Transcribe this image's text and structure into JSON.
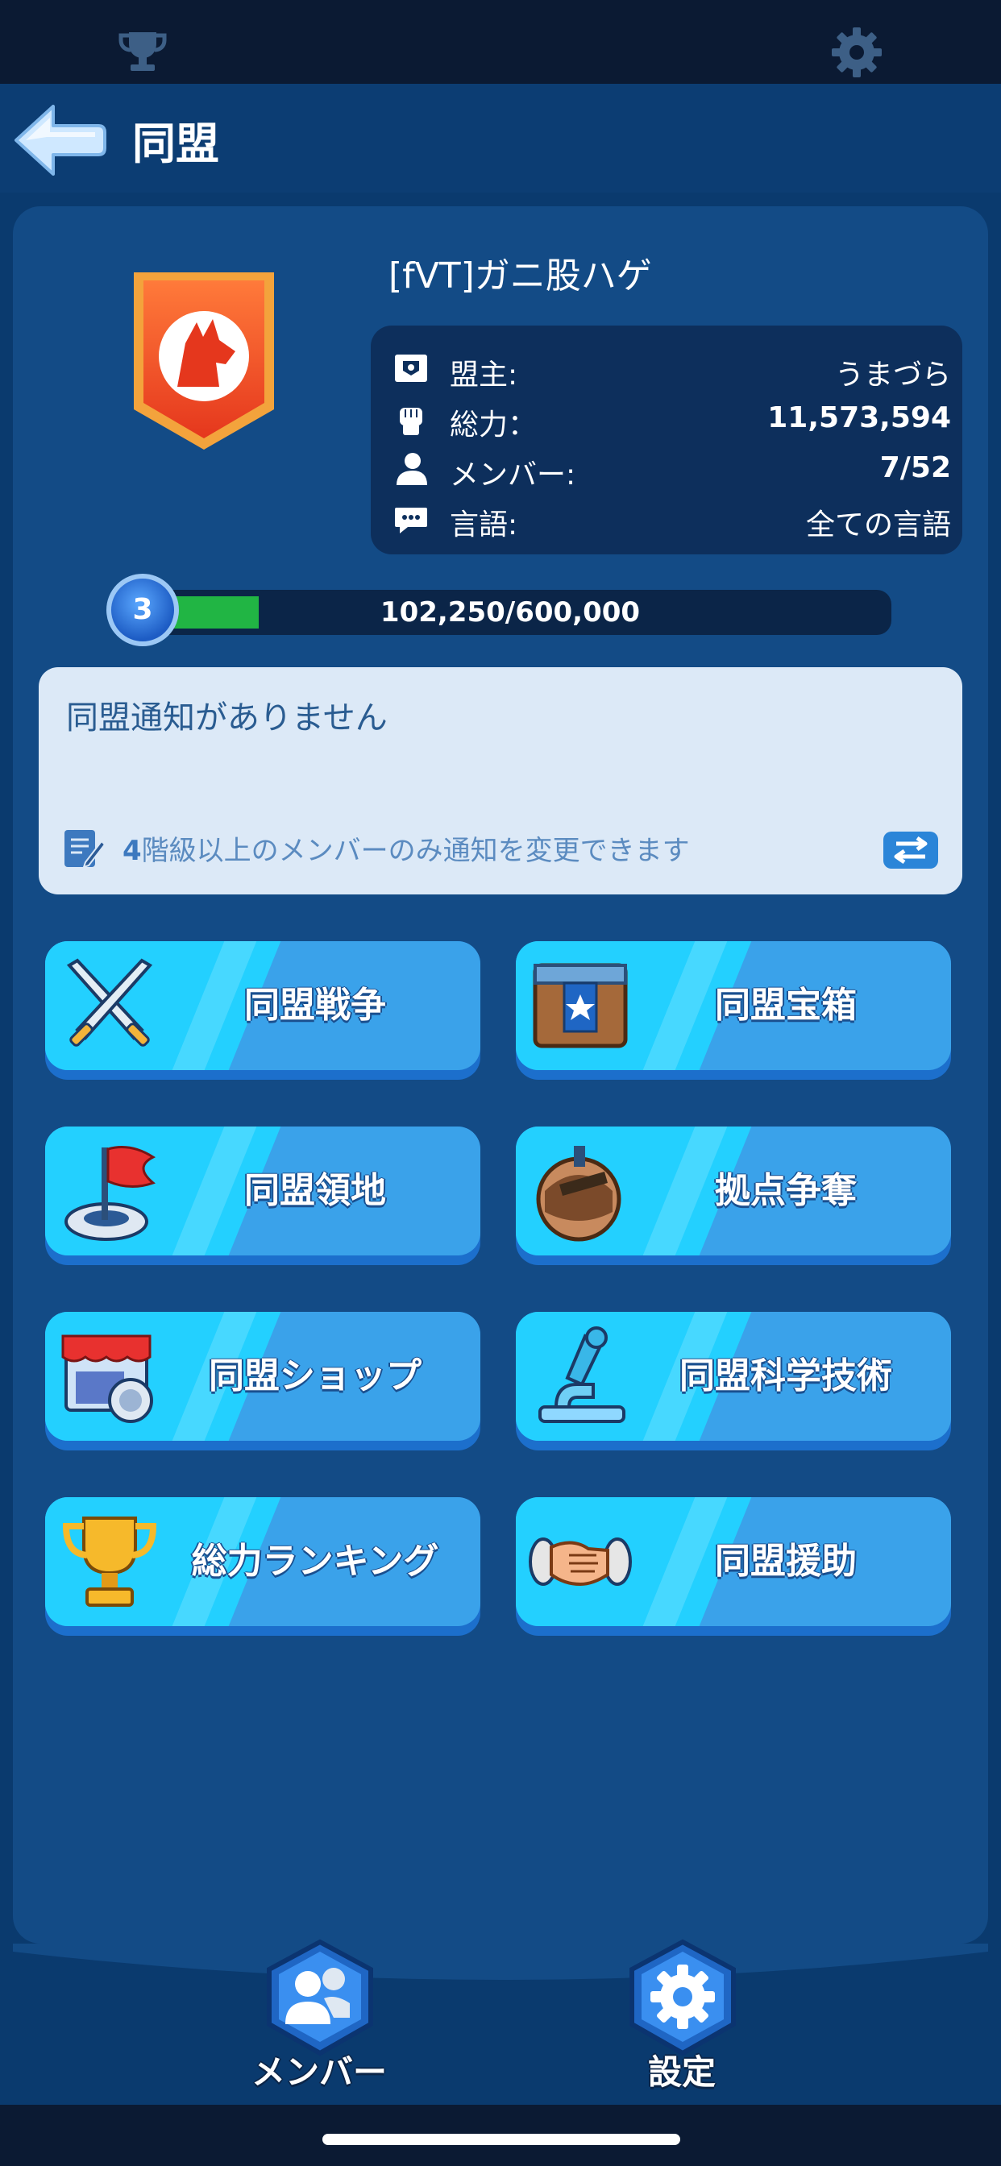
{
  "header": {
    "title": "同盟"
  },
  "alliance": {
    "name": "[fVT]ガニ股ハゲ",
    "info": [
      {
        "label": "盟主:",
        "value": "うまづら",
        "icon": "leader-flag-icon"
      },
      {
        "label": "総力：",
        "value": "11,573,594",
        "icon": "fist-icon"
      },
      {
        "label": "メンバー:",
        "value": "7/52",
        "icon": "person-icon"
      },
      {
        "label": "言語:",
        "value": "全ての言語",
        "icon": "chat-bubble-icon"
      }
    ],
    "level": "3",
    "progress_text": "102,250/600,000",
    "progress_fraction": 0.17
  },
  "notice": {
    "text": "同盟通知がありません",
    "hint_num": "4",
    "hint_text": "階級以上のメンバーのみ通知を変更できます"
  },
  "menu": [
    {
      "label": "同盟戦争",
      "icon": "crossed-swords-icon"
    },
    {
      "label": "同盟宝箱",
      "icon": "treasure-chest-icon"
    },
    {
      "label": "同盟領地",
      "icon": "red-flag-icon"
    },
    {
      "label": "拠点争奪",
      "icon": "cannon-base-icon"
    },
    {
      "label": "同盟ショップ",
      "icon": "shop-icon"
    },
    {
      "label": "同盟科学技術",
      "icon": "microscope-icon"
    },
    {
      "label": "総力ランキング",
      "icon": "gold-trophy-icon"
    },
    {
      "label": "同盟援助",
      "icon": "handshake-icon"
    }
  ],
  "bottom_nav": {
    "members_label": "メンバー",
    "settings_label": "設定"
  },
  "colors": {
    "background": "#0a3a6e",
    "panel": "#134b86",
    "button_face": "#3aa2ea",
    "button_stripe": "#23d0ff",
    "progress_fill": "#21b544"
  }
}
